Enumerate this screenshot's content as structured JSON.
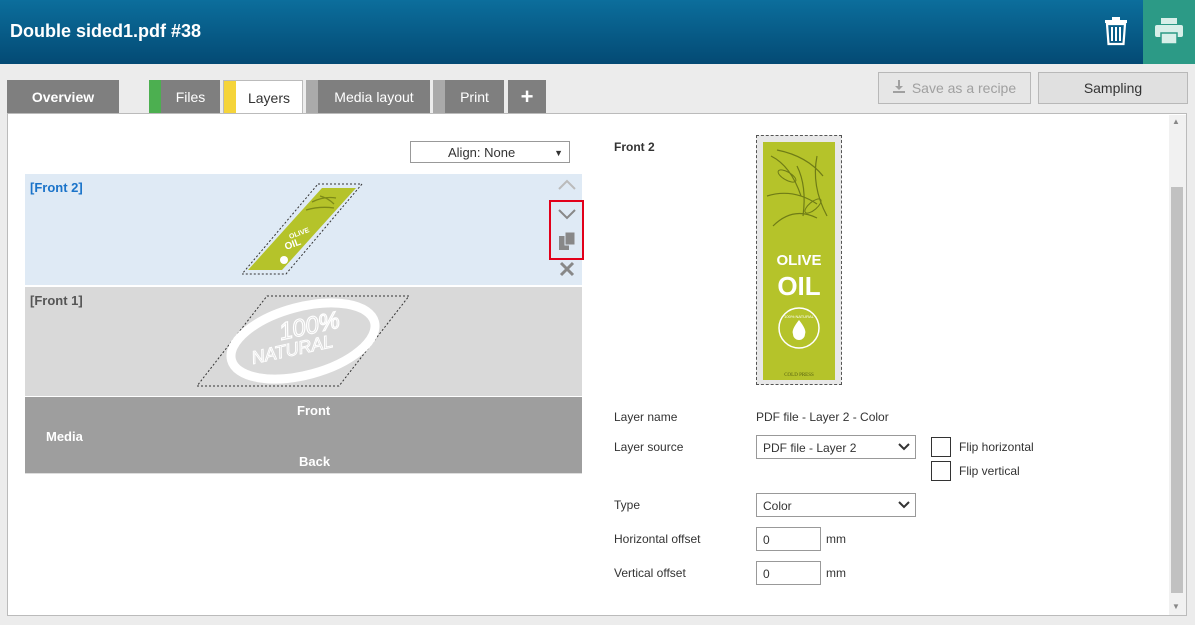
{
  "header": {
    "title": "Double sided1.pdf #38"
  },
  "tabs": [
    {
      "label": "Overview",
      "stripe": ""
    },
    {
      "label": "Files",
      "stripe": "#4caf50"
    },
    {
      "label": "Layers",
      "stripe": "#f5d43a"
    },
    {
      "label": "Media layout",
      "stripe": "#aaaaaa"
    },
    {
      "label": "Print",
      "stripe": "#aaaaaa"
    },
    {
      "label": "+"
    }
  ],
  "toolbar": {
    "save_recipe": "Save as a recipe",
    "sampling": "Sampling"
  },
  "align": {
    "value": "Align: None"
  },
  "layers": [
    {
      "name": "[Front 2]"
    },
    {
      "name": "[Front 1]"
    }
  ],
  "label_art": {
    "olive": "OLIVE",
    "oil": "OIL",
    "natural_pct": "100%",
    "natural": "NATURAL",
    "badge": "100% NATURAL",
    "cold_press": "COLD PRESS"
  },
  "media": {
    "front": "Front",
    "media": "Media",
    "back": "Back"
  },
  "details": {
    "section_title": "Front 2",
    "layer_name_label": "Layer name",
    "layer_name_value": "PDF file - Layer 2 - Color",
    "layer_source_label": "Layer source",
    "layer_source_value": "PDF file - Layer 2",
    "flip_horizontal": "Flip horizontal",
    "flip_vertical": "Flip vertical",
    "type_label": "Type",
    "type_value": "Color",
    "h_offset_label": "Horizontal offset",
    "h_offset_value": "0",
    "v_offset_label": "Vertical offset",
    "v_offset_value": "0",
    "unit": "mm"
  },
  "colors": {
    "header_top": "#0c6e9c",
    "accent_green": "#2c9a86",
    "label_green": "#b5c32a",
    "highlight": "#e2001a"
  }
}
